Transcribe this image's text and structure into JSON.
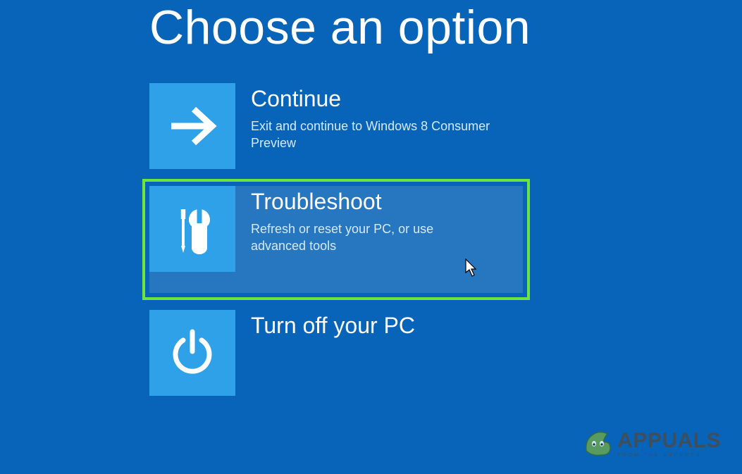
{
  "title": "Choose an option",
  "options": [
    {
      "title": "Continue",
      "desc": "Exit and continue to Windows 8 Consumer Preview",
      "icon": "arrow-right"
    },
    {
      "title": "Troubleshoot",
      "desc": "Refresh or reset your PC, or use advanced tools",
      "icon": "tools",
      "highlighted": true
    },
    {
      "title": "Turn off your PC",
      "desc": "",
      "icon": "power"
    }
  ],
  "watermark": {
    "brand": "APPUALS",
    "tagline": "FROM THE EXPERTS"
  }
}
